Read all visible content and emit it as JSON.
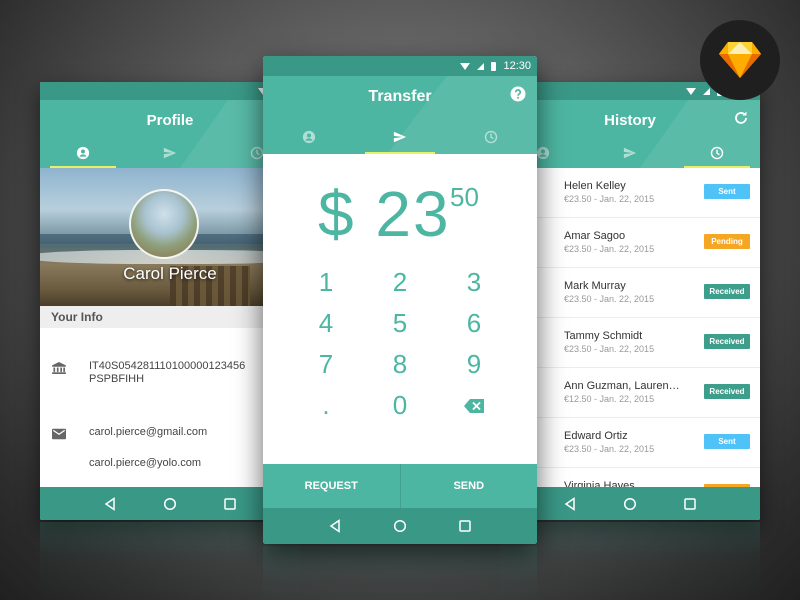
{
  "status": {
    "time": "12:30"
  },
  "profile": {
    "title": "Profile",
    "name": "Carol Pierce",
    "section_header": "Your Info",
    "iban_line1": "IT40S054281110100000123456",
    "iban_line2": "PSPBFIHH",
    "email_primary": "carol.pierce@gmail.com",
    "email_secondary": "carol.pierce@yolo.com",
    "icons": [
      "user-icon",
      "send-icon",
      "clock-icon",
      "bank-icon",
      "mail-icon"
    ]
  },
  "transfer": {
    "title": "Transfer",
    "amount_main": "$ 23",
    "amount_cents": "50",
    "keys": [
      "1",
      "2",
      "3",
      "4",
      "5",
      "6",
      "7",
      "8",
      "9",
      ".",
      "0"
    ],
    "request_label": "REQUEST",
    "send_label": "SEND",
    "icons": [
      "help-icon",
      "user-icon",
      "send-icon",
      "clock-icon",
      "backspace-icon"
    ]
  },
  "history": {
    "title": "History",
    "items": [
      {
        "name": "Helen Kelley",
        "detail": "€23.50 - Jan. 22, 2015",
        "status": "Sent"
      },
      {
        "name": "Amar Sagoo",
        "detail": "€23.50 - Jan. 22, 2015",
        "status": "Pending"
      },
      {
        "name": "Mark Murray",
        "detail": "€23.50 - Jan. 22, 2015",
        "status": "Received"
      },
      {
        "name": "Tammy Schmidt",
        "detail": "€23.50 - Jan. 22, 2015",
        "status": "Received"
      },
      {
        "name": "Ann Guzman, Lauren…",
        "detail": "€12.50 - Jan. 22, 2015",
        "status": "Received"
      },
      {
        "name": "Edward Ortiz",
        "detail": "€23.50 - Jan. 22, 2015",
        "status": "Sent"
      },
      {
        "name": "Virginia Hayes",
        "detail": "",
        "status": ""
      }
    ],
    "icons": [
      "refresh-icon",
      "user-icon",
      "send-icon",
      "clock-icon"
    ]
  },
  "navigation": {
    "icons": [
      "back-icon",
      "home-icon",
      "recents-icon"
    ]
  },
  "badge": {
    "icon": "sketch-logo"
  },
  "colors": {
    "primary": "#4db6a2",
    "primary_dark": "#3a9887",
    "tab_indicator": "#e9f065",
    "sent": "#4fc3f7",
    "pending": "#f5a623",
    "received": "#3e9e8c"
  }
}
